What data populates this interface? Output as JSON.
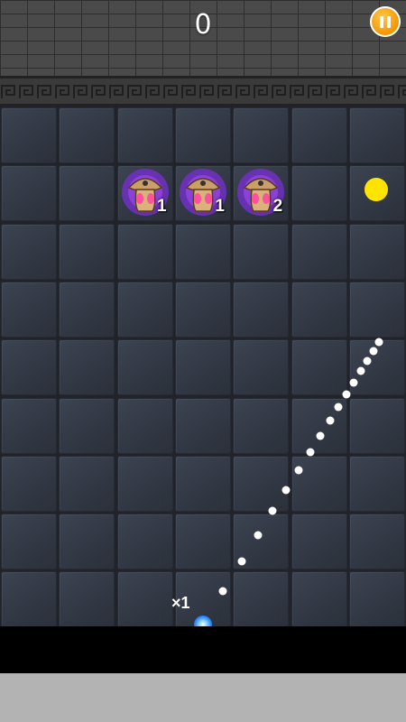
{
  "header": {
    "score": "0",
    "pause_icon": "pause-icon"
  },
  "board": {
    "columns": 7,
    "rows": 9,
    "monsters": [
      {
        "row": 1,
        "col": 2,
        "hits": "1",
        "icon": "mushroom-monster-icon"
      },
      {
        "row": 1,
        "col": 3,
        "hits": "1",
        "icon": "mushroom-monster-icon"
      },
      {
        "row": 1,
        "col": 4,
        "hits": "2",
        "icon": "mushroom-monster-icon"
      }
    ],
    "pickup": {
      "row": 1,
      "col": 6,
      "icon": "extra-ball-icon",
      "color": "#ffe400"
    }
  },
  "launcher": {
    "ball_count": "×1",
    "ball_color": "#1e84ff"
  },
  "colors": {
    "pause_button": "#f29600",
    "aim_dots": "#ffffff"
  }
}
